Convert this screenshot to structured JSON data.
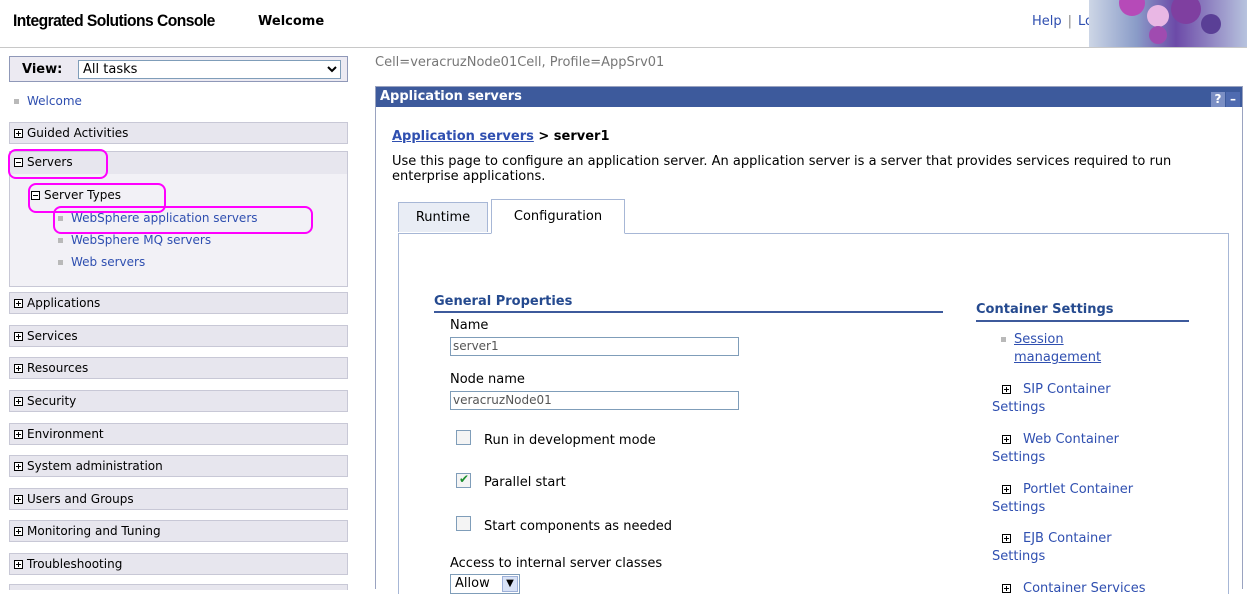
{
  "header": {
    "app_title": "Integrated Solutions Console",
    "welcome": "Welcome",
    "help": "Help",
    "separator": "|",
    "logout": "Logout"
  },
  "nav": {
    "view_label": "View:",
    "view_value": "All tasks",
    "welcome_link": "Welcome",
    "guided": "Guided Activities",
    "servers": "Servers",
    "server_types": "Server Types",
    "server_items": [
      "WebSphere application servers",
      "WebSphere MQ servers",
      "Web servers"
    ],
    "categories": [
      "Applications",
      "Services",
      "Resources",
      "Security",
      "Environment",
      "System administration",
      "Users and Groups",
      "Monitoring and Tuning",
      "Troubleshooting"
    ]
  },
  "content": {
    "cell_info": "Cell=veracruzNode01Cell, Profile=AppSrv01",
    "portlet_title": "Application servers",
    "help_btn": "?",
    "min_btn": "–",
    "breadcrumb_link": "Application servers",
    "breadcrumb_rest": " > server1",
    "description": "Use this page to configure an application server. An application server is a server that provides services required to run enterprise applications.",
    "tabs": [
      "Runtime",
      "Configuration"
    ],
    "general_properties": "General Properties",
    "name_label": "Name",
    "name_value": "server1",
    "node_label": "Node name",
    "node_value": "veracruzNode01",
    "dev_mode": "Run in development mode",
    "parallel_start": "Parallel start",
    "start_components": "Start components as needed",
    "access_label": "Access to internal server classes",
    "access_value": "Allow",
    "container_settings": "Container Settings",
    "session_mgmt": "Session management",
    "sip": "SIP Container Settings",
    "web": "Web Container Settings",
    "portlet": "Portlet Container Settings",
    "ejb": "EJB Container Settings",
    "container_services": "Container Services"
  },
  "state": {
    "dev_mode_checked": false,
    "parallel_start_checked": true,
    "start_components_checked": false
  }
}
